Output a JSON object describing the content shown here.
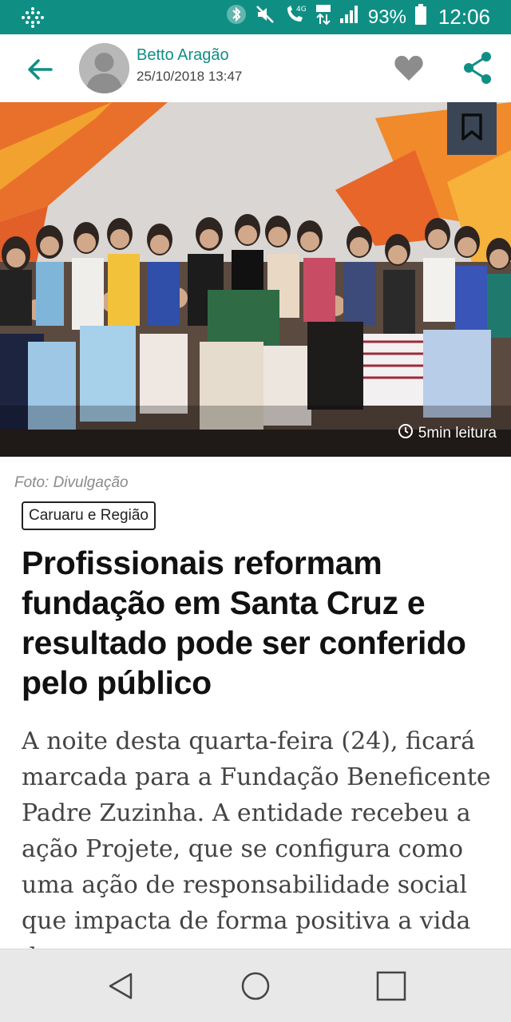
{
  "status_bar": {
    "battery": "93%",
    "time": "12:06",
    "network_label": "4G",
    "colors": {
      "background": "#0f8f84"
    }
  },
  "header": {
    "author": "Betto Aragão",
    "date": "25/10/2018 13:47",
    "icons": [
      "back-arrow-icon",
      "avatar",
      "heart-icon",
      "share-icon"
    ]
  },
  "hero": {
    "read_time": "5min leitura",
    "icons": [
      "bookmark-icon",
      "clock-icon"
    ]
  },
  "article": {
    "caption": "Foto: Divulgação",
    "category": "Caruaru e Região",
    "headline": "Profissionais reformam fundação em Santa Cruz e resultado pode ser conferido pelo público",
    "body": "A noite desta quarta-feira (24), ficará marcada para a Fundação Beneficente Padre Zuzinha. A entidade recebeu a ação Projete, que se configura como uma ação de responsabilidade social que impacta de forma positiva a vida de"
  },
  "nav_bar": {
    "icons": [
      "back-triangle-icon",
      "home-circle-icon",
      "recents-square-icon"
    ]
  },
  "colors": {
    "accent": "#0f8f84",
    "headline": "#111111",
    "body": "#444444",
    "bookmark_bg": "#3a4656"
  }
}
